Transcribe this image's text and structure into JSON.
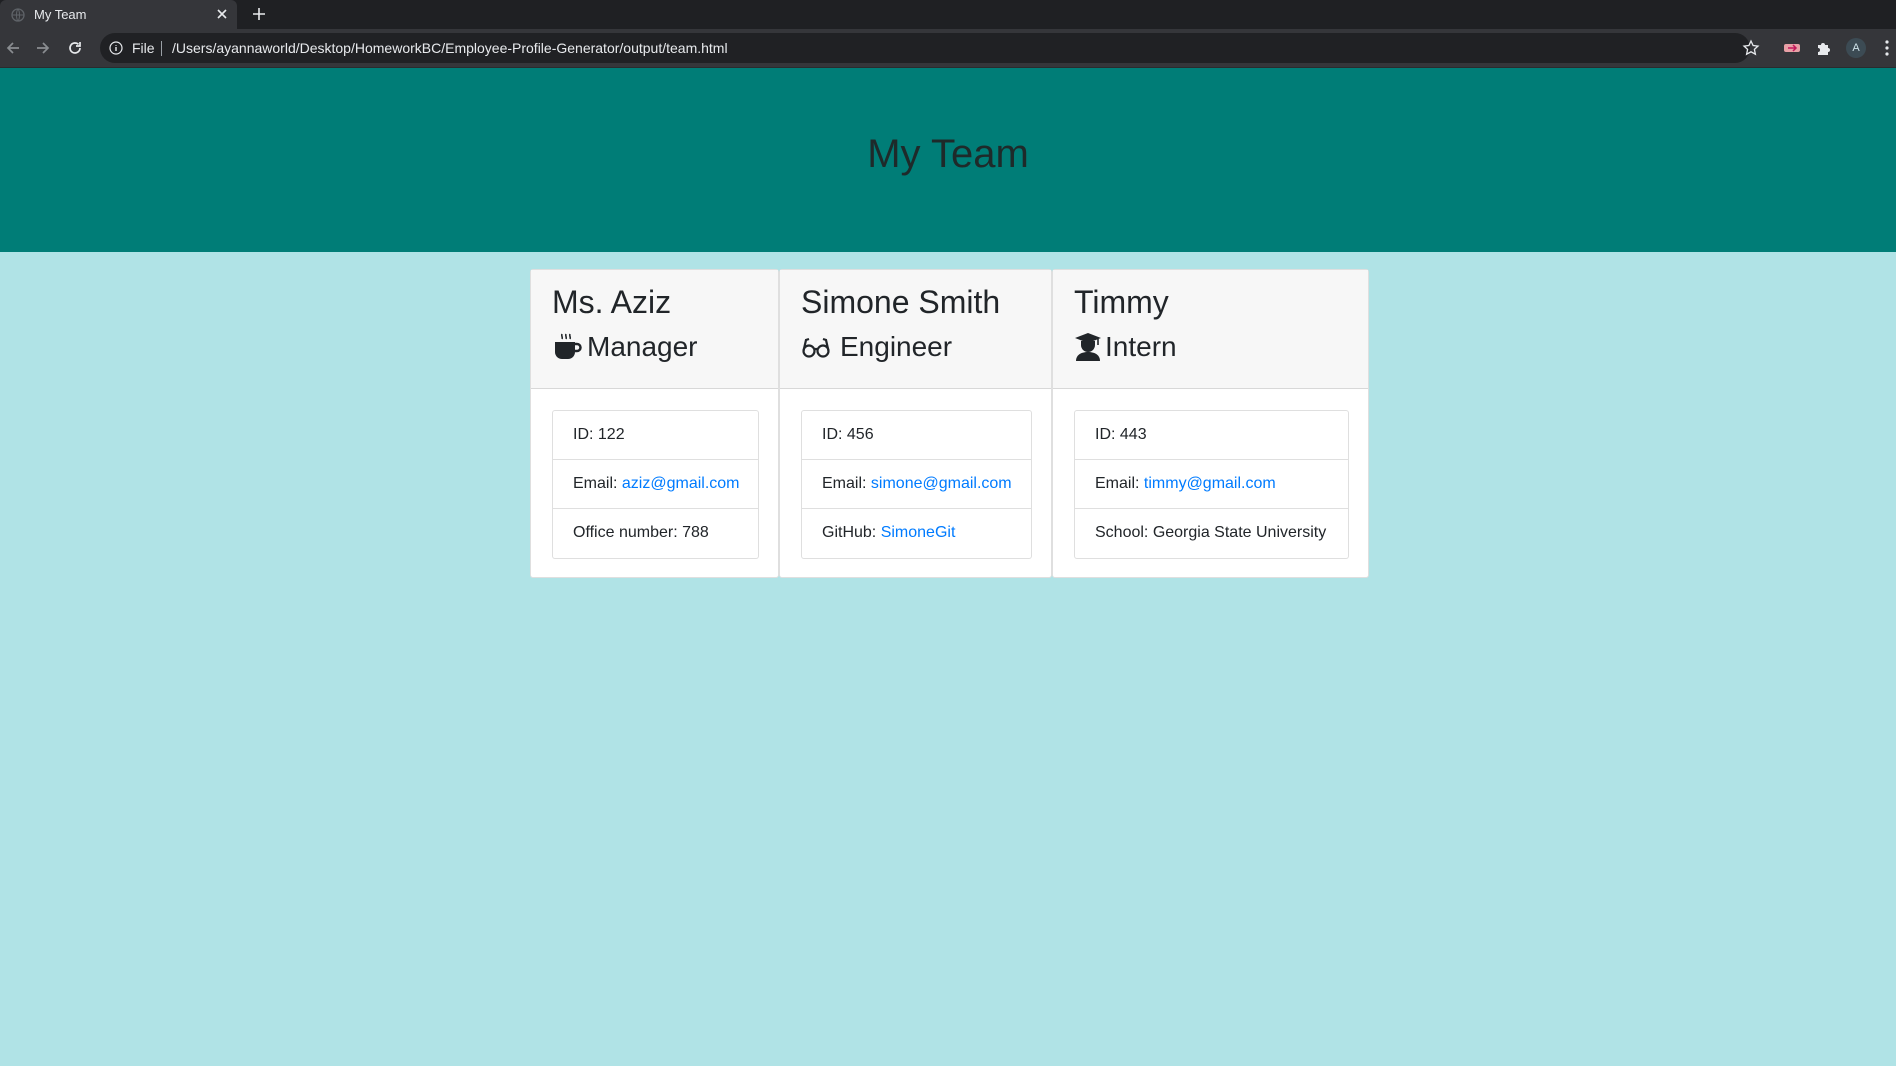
{
  "browser": {
    "tab_title": "My Team",
    "scheme_label": "File",
    "url": "/Users/ayannaworld/Desktop/HomeworkBC/Employee-Profile-Generator/output/team.html",
    "avatar_letter": "A"
  },
  "page": {
    "title": "My Team",
    "header_color": "#007d77",
    "background_color": "#b0e3e6"
  },
  "team": [
    {
      "name": "Ms. Aziz",
      "role": "Manager",
      "icon": "coffee-mug-icon",
      "id_text": "ID: 122",
      "email_label": "Email: ",
      "email": "aziz@gmail.com",
      "extra_label": "Office number: 788",
      "extra_link": ""
    },
    {
      "name": "Simone Smith",
      "role": "Engineer",
      "icon": "glasses-icon",
      "id_text": "ID: 456",
      "email_label": "Email: ",
      "email": "simone@gmail.com",
      "extra_label": "GitHub: ",
      "extra_link": "SimoneGit"
    },
    {
      "name": "Timmy",
      "role": "Intern",
      "icon": "graduate-icon",
      "id_text": "ID: 443",
      "email_label": "Email: ",
      "email": "timmy@gmail.com",
      "extra_label": "School: Georgia State University",
      "extra_link": ""
    }
  ]
}
